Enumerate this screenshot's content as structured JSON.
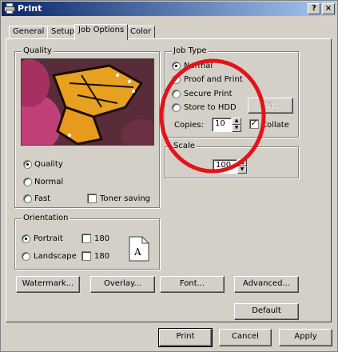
{
  "window": {
    "title": "Print",
    "help_label": "?",
    "close_label": "×"
  },
  "tabs": [
    "General",
    "Setup",
    "Job Options",
    "Color"
  ],
  "quality": {
    "legend": "Quality",
    "options": [
      "Quality",
      "Normal",
      "Fast"
    ],
    "selected": "Quality",
    "toner_saving_label": "Toner saving",
    "toner_saving_checked": false
  },
  "job_type": {
    "legend": "Job Type",
    "options": [
      "Normal",
      "Proof and Print",
      "Secure Print",
      "Store to HDD"
    ],
    "selected": "Normal",
    "pin_label": "PIN...",
    "copies_label": "Copies:",
    "copies_value": "10",
    "collate_label": "Collate",
    "collate_checked": true,
    "collate_mark": "✓"
  },
  "scale": {
    "legend": "Scale",
    "value": "100"
  },
  "orientation": {
    "legend": "Orientation",
    "options": [
      "Portrait",
      "Landscape"
    ],
    "selected": "Portrait",
    "rotate_label": "180",
    "preview_letter": "A"
  },
  "action_buttons": [
    "Watermark...",
    "Overlay...",
    "Font...",
    "Advanced..."
  ],
  "default_label": "Default",
  "dialog_buttons": [
    "Print",
    "Cancel",
    "Apply"
  ],
  "annotation_color": "#e2141b"
}
